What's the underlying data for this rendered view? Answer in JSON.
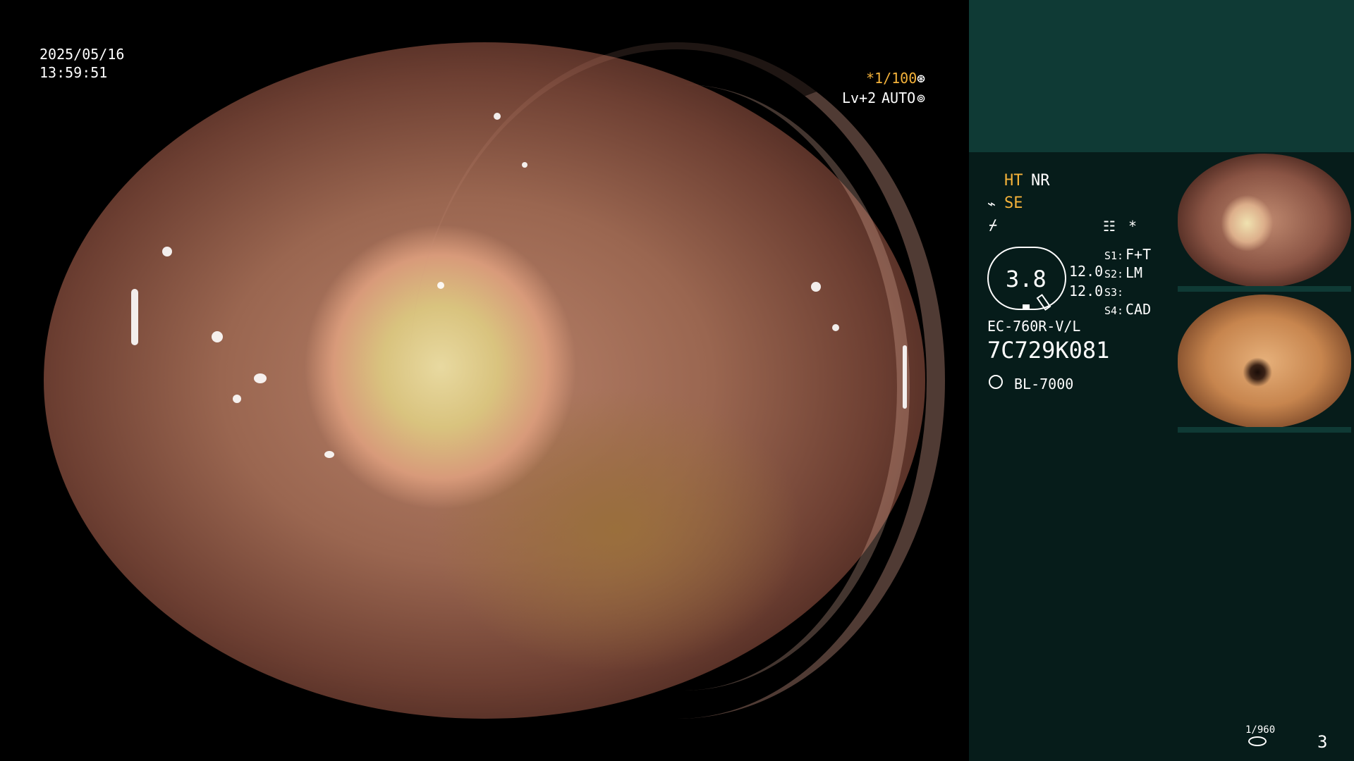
{
  "overlay": {
    "date": "2025/05/16",
    "time": "13:59:51",
    "shutter": "*1/100",
    "level": "Lv+2",
    "iris_mode": "AUTO"
  },
  "panel": {
    "ht": "HT",
    "nr": "NR",
    "se": "SE",
    "structure_icon": "waveform-icon",
    "enhance_icon": "slash-icon",
    "menu_icon": "list-icon",
    "asterisk": "*",
    "zoom_value": "3.8",
    "zoom_a": "12.0",
    "zoom_b": "12.0",
    "s1_label": "S1:",
    "s1_value": "F+T",
    "s2_label": "S2:",
    "s2_value": "LM",
    "s3_label": "S3:",
    "s3_value": "",
    "s4_label": "S4:",
    "s4_value": "CAD",
    "scope_model": "EC-760R-V/L",
    "scope_serial": "7C729K081",
    "light_source": "BL-7000",
    "counter": "1/960",
    "frame_number": "3"
  },
  "colors": {
    "accent": "#f4b23a",
    "panel_top": "#0f3a35",
    "panel_bottom": "#061c1a"
  }
}
